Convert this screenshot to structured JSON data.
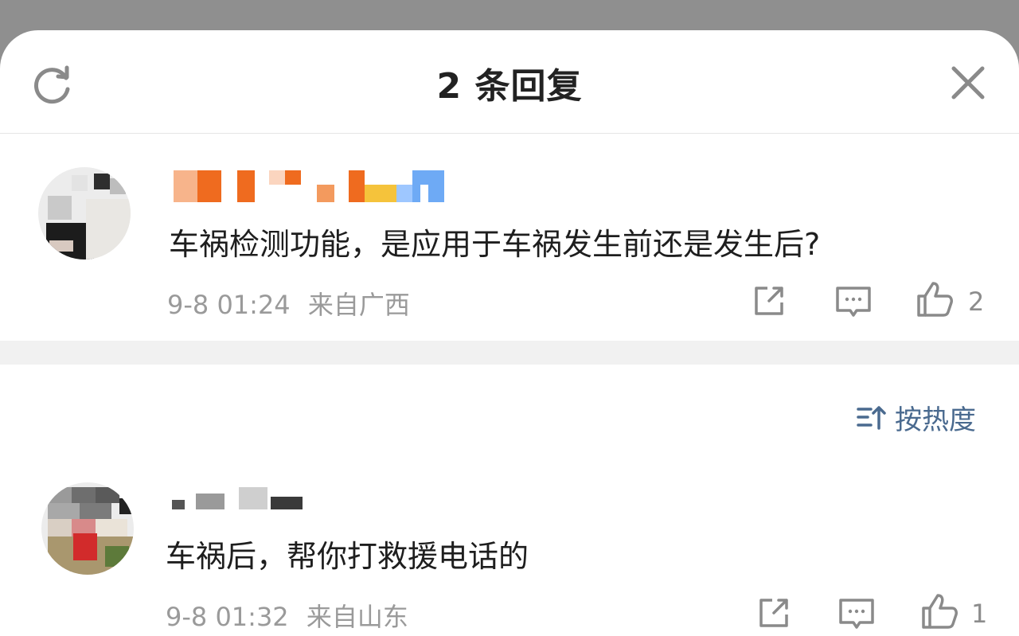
{
  "header": {
    "title": "2 条回复"
  },
  "root_comment": {
    "text": "车祸检测功能，是应用于车祸发生前还是发生后?",
    "time": "9-8 01:24",
    "source": "来自广西",
    "likes": "2"
  },
  "sort": {
    "label": "按热度"
  },
  "reply": {
    "text": "车祸后，帮你打救援电话的",
    "time": "9-8 01:32",
    "source": "来自山东",
    "likes": "1"
  },
  "colors": {
    "icon_gray": "#8a8a8a",
    "sort_blue": "#4a6a8f"
  }
}
